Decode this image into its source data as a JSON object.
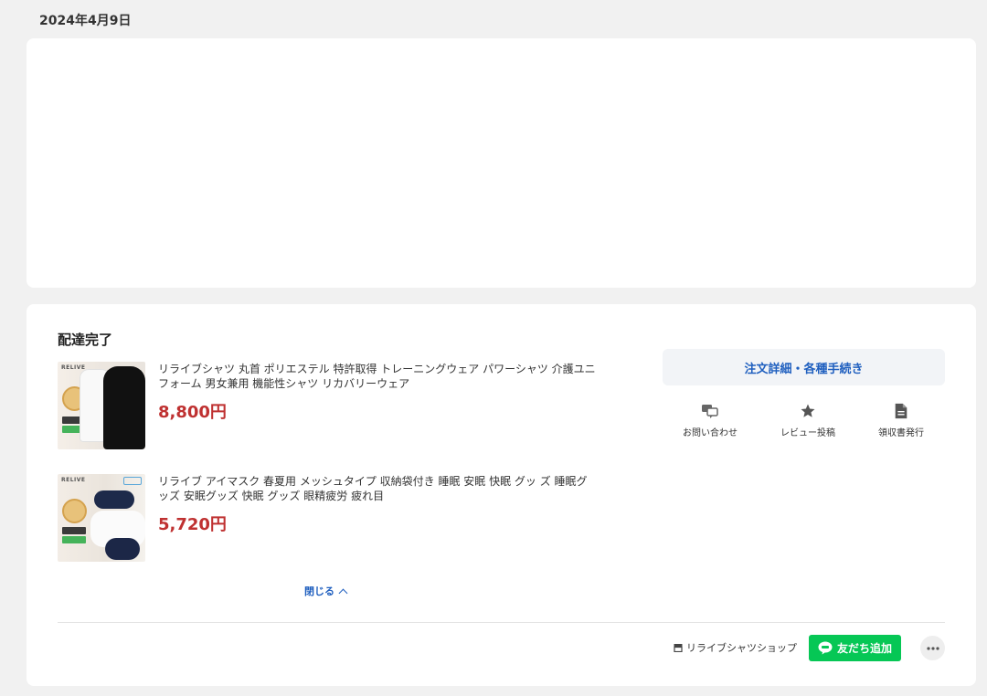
{
  "date_header": "2024年4月9日",
  "order": {
    "status": "配達完了",
    "items": [
      {
        "title": "リライブシャツ 丸首 ポリエステル 特許取得 トレーニングウェア パワーシャツ 介護ユニフォーム 男女兼用 機能性シャツ リカバリーウェア",
        "price": "8,800円",
        "thumb_logo": "RELIVE"
      },
      {
        "title": "リライブ アイマスク 春夏用 メッシュタイプ 収納袋付き 睡眠 安眠 快眠 グッ ズ 睡眠グッズ 安眠グッズ 快眠 グッズ 眼精疲労 疲れ目",
        "price": "5,720円",
        "thumb_logo": "RELIVE"
      }
    ],
    "collapse_label": "閉じる",
    "detail_button": "注文詳細・各種手続き",
    "actions": [
      {
        "label": "お問い合わせ",
        "icon": "chat-icon"
      },
      {
        "label": "レビュー投稿",
        "icon": "star-icon"
      },
      {
        "label": "領収書発行",
        "icon": "document-icon"
      }
    ],
    "shop_name": "リライブシャツショップ",
    "line_button": "友だち追加",
    "colors": {
      "price": "#bf3131",
      "link": "#1f5fbf",
      "line_green": "#06c755"
    }
  }
}
